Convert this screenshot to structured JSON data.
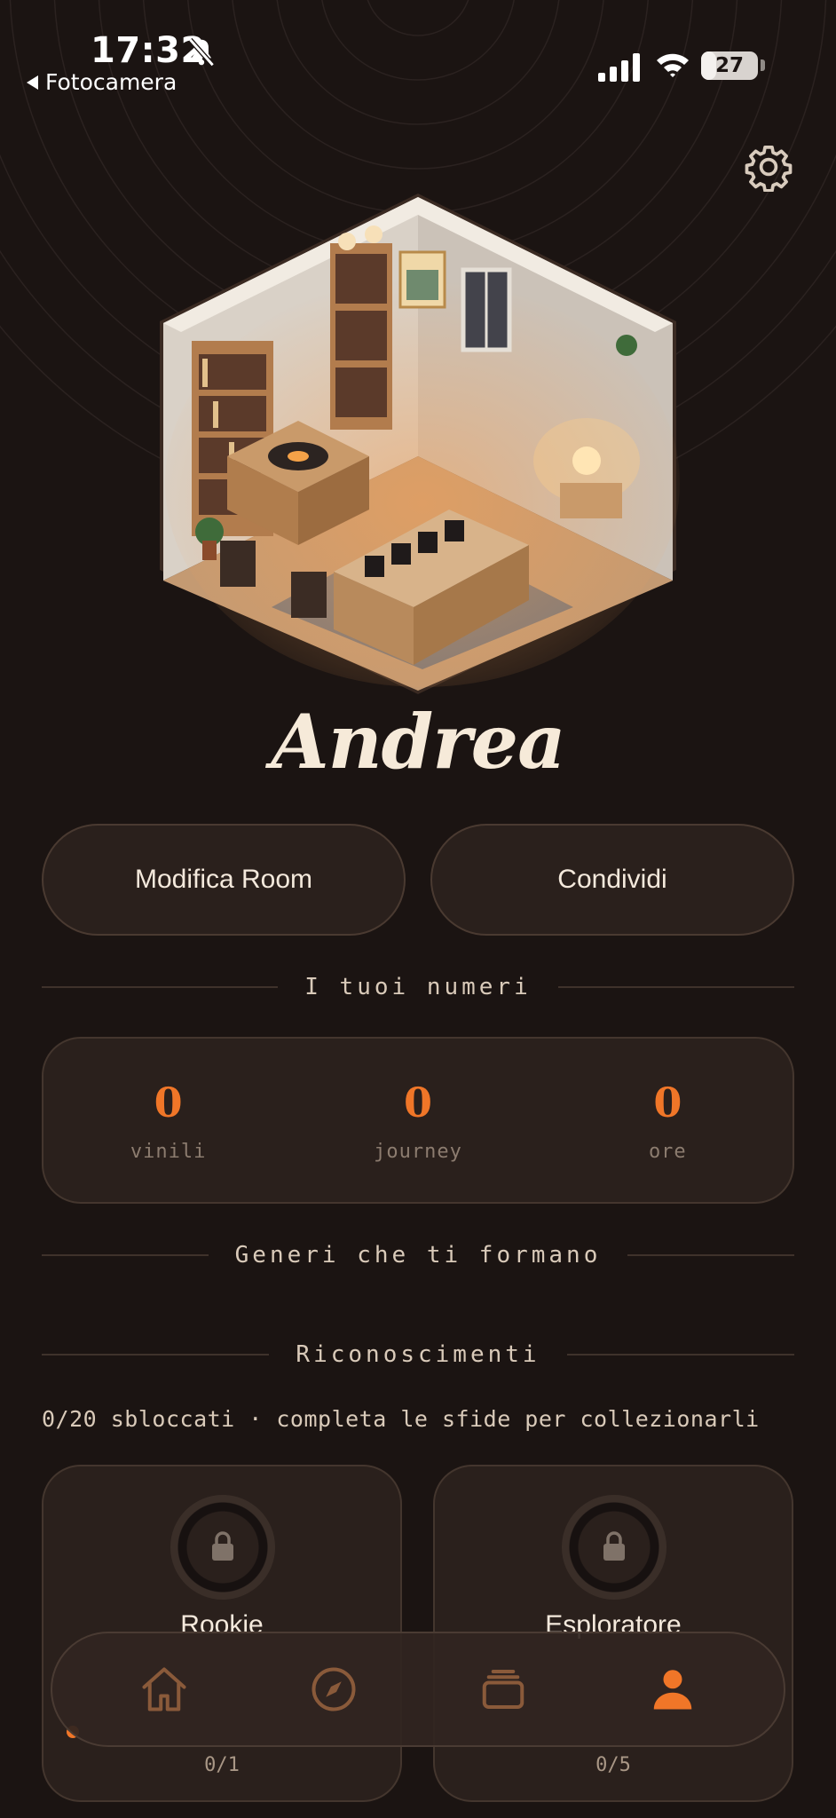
{
  "status_bar": {
    "time": "17:32",
    "back_label": "Fotocamera",
    "battery": "27",
    "battery_level_percent": 27
  },
  "profile": {
    "name": "Andrea",
    "edit_room_label": "Modifica Room",
    "share_label": "Condividi"
  },
  "numbers_section": {
    "title": "I tuoi numeri",
    "stats": [
      {
        "value": "0",
        "label": "vinili"
      },
      {
        "value": "0",
        "label": "journey"
      },
      {
        "value": "0",
        "label": "ore"
      }
    ]
  },
  "genres_section": {
    "title": "Generi che ti formano"
  },
  "badges_section": {
    "title": "Riconoscimenti",
    "subtitle": "0/20 sbloccati · completa le sfide per collezionarli",
    "badges": [
      {
        "title": "Rookie",
        "progress": "0/1"
      },
      {
        "title": "Esploratore",
        "progress": "0/5"
      }
    ]
  },
  "nav": {
    "items": [
      "home-icon",
      "compass-icon",
      "collection-icon",
      "profile-icon"
    ],
    "active": "profile-icon"
  },
  "colors": {
    "background": "#1b1412",
    "card": "#2a201c",
    "accent": "#f07628",
    "text": "#efe3d4",
    "muted": "#8c7c6f"
  }
}
